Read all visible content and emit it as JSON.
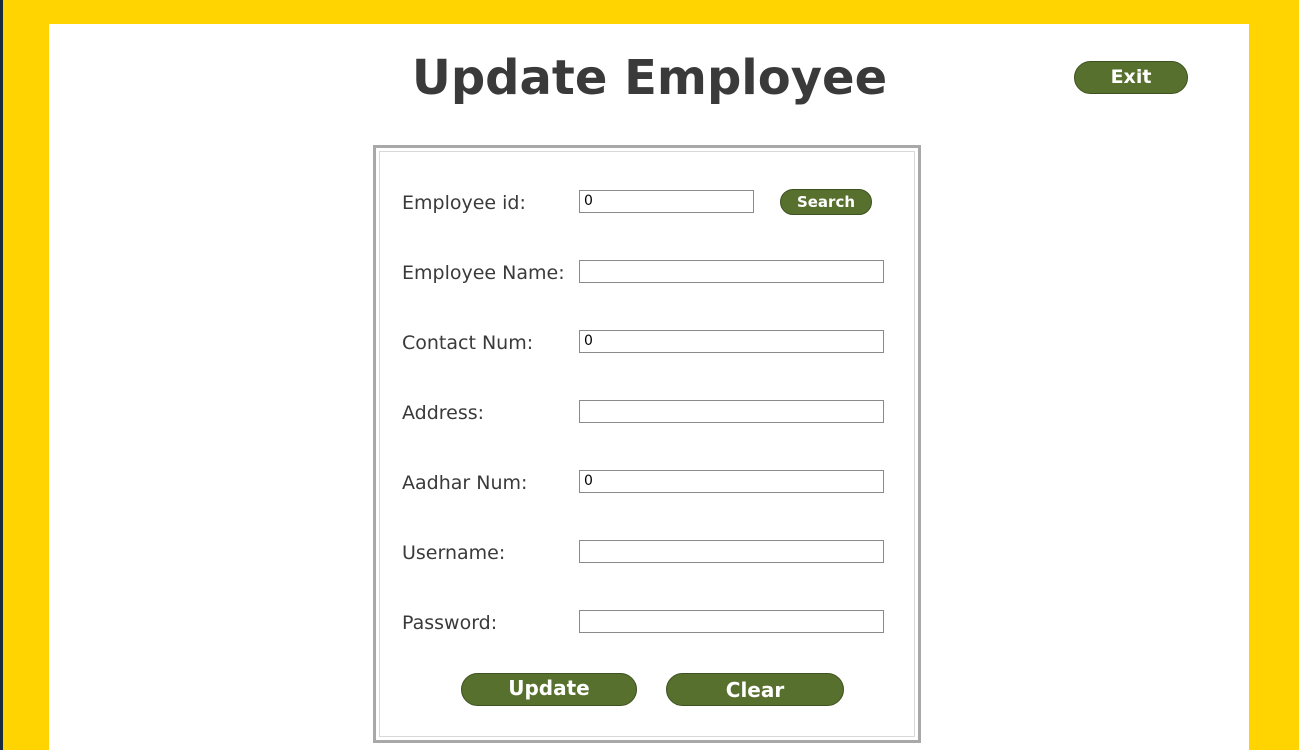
{
  "window": {
    "title": "Update Employee"
  },
  "header": {
    "exit_label": "Exit"
  },
  "form": {
    "employee_id": {
      "label": "Employee id:",
      "value": "0"
    },
    "search_label": "Search",
    "employee_name": {
      "label": "Employee Name:",
      "value": ""
    },
    "contact_num": {
      "label": "Contact Num:",
      "value": "0"
    },
    "address": {
      "label": "Address:",
      "value": ""
    },
    "aadhar_num": {
      "label": "Aadhar Num:",
      "value": "0"
    },
    "username": {
      "label": "Username:",
      "value": ""
    },
    "password": {
      "label": "Password:",
      "value": ""
    },
    "update_label": "Update",
    "clear_label": "Clear"
  },
  "colors": {
    "frame": "#ffd400",
    "panel": "#ffffff",
    "button": "#57702e",
    "button_text": "#ffffff",
    "title_text": "#3a3a3a"
  }
}
